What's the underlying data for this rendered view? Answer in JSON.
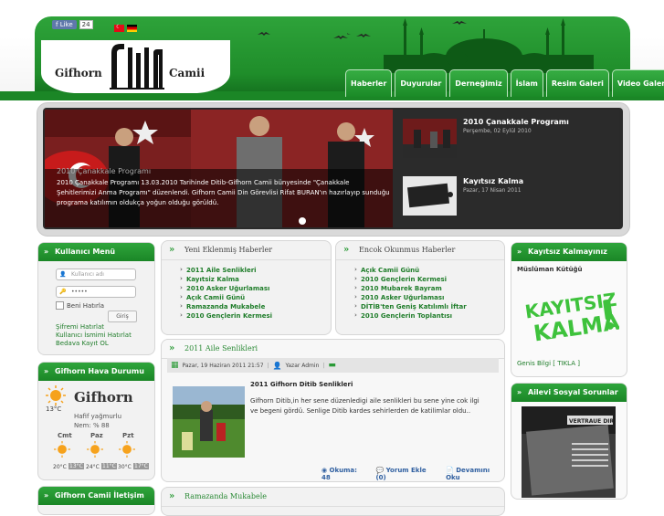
{
  "colors": {
    "brand_green": "#1f8d2a",
    "link_green": "#1f7d2a"
  },
  "facebook": {
    "like_label": "Like",
    "like_count": "24"
  },
  "logo": {
    "left": "Gifhorn",
    "right": "Camii"
  },
  "nav": {
    "items": [
      "Haberler",
      "Duyurular",
      "Derneğimiz",
      "İslam",
      "Resim Galeri",
      "Video Galeri"
    ]
  },
  "slider": {
    "caption_title": "2010 Çanakkale Programı",
    "caption_text": "2010 Çanakkale Programı 13.03.2010 Tarihinde Ditib-Gifhorn Camii bünyesinde \"Çanakkale Şehitlerimizi Anma Programı\" düzenlendi. Gifhorn Camii Din Görevlisi Rifat BURAN'ın hazırlayıp sunduğu programa katılımın oldukça yoğun olduğu görüldü.",
    "thumbs": [
      {
        "title": "2010 Çanakkale Programı",
        "date": "Perşembe, 02 Eylül 2010"
      },
      {
        "title": "Kayıtsız Kalma",
        "date": "Pazar, 17 Nisan 2011"
      }
    ]
  },
  "login": {
    "title": "Kullanıcı Menü",
    "username_placeholder": "Kullanıcı adı",
    "password_value": "•••••",
    "remember_label": "Beni Hatırla",
    "submit_label": "Giriş",
    "links": [
      "Şifremi Hatırlat",
      "Kullanıcı İsmimi Hatırlat",
      "Bedava Kayıt OL"
    ]
  },
  "weather": {
    "title": "Gifhorn Hava Durumu",
    "temp": "13°C",
    "city": "Gifhorn",
    "condition": "Hafif yağmurlu",
    "humidity": "Nem: % 88",
    "days": [
      {
        "name": "Cmt",
        "high": "20°C",
        "low": "13°C"
      },
      {
        "name": "Paz",
        "high": "24°C",
        "low": "11°C"
      },
      {
        "name": "Pzt",
        "high": "30°C",
        "low": "17°C"
      }
    ]
  },
  "contact_title": "Gifhorn Camii İletişim",
  "latest": {
    "title": "Yeni Eklenmiş Haberler",
    "items": [
      "2011 Aile Senlikleri",
      "Kayıtsiz Kalma",
      "2010 Asker Uğurlaması",
      "Açık Camii Günü",
      "Ramazanda Mukabele",
      "2010 Gençlerin Kermesi"
    ]
  },
  "popular": {
    "title": "Encok Okunmus Haberler",
    "items": [
      "Açık Camii Günü",
      "2010 Gençlerin Kermesi",
      "2010 Mubarek Bayram",
      "2010 Asker Uğurlaması",
      "DİTİB'ten Geniş Katılımlı İftar",
      "2010 Gençlerin Toplantısı"
    ]
  },
  "article": {
    "section_title": "2011 Aile Senlikleri",
    "date": "Pazar, 19 Haziran 2011 21:57",
    "author": "Yazar Admin",
    "headline": "2011 Gifhorn Ditib Senlikleri",
    "body": "Gifhorn Ditib,in her sene düzenledigi aile senlikleri bu sene yine cok ilgi ve begeni gördü. Senlige Ditib kardes sehirlerden de katilimlar oldu..",
    "reads": "Okuma: 48",
    "comment": "Yorum Ekle (0)",
    "more": "Devamını Oku"
  },
  "campaign": {
    "title": "Kayıtsız Kalmayınız",
    "subtitle": "Müslüman Kütüğü",
    "logo_text_1": "KAYITSIZ",
    "logo_text_2": "KALMA",
    "detail_link": "Genis Bilgi [ TIKLA ]"
  },
  "family": {
    "title": "Ailevi Sosyal Sorunlar",
    "poster_text": "VERTRAUE DIR"
  },
  "next_section_title": "Ramazanda Mukabele"
}
